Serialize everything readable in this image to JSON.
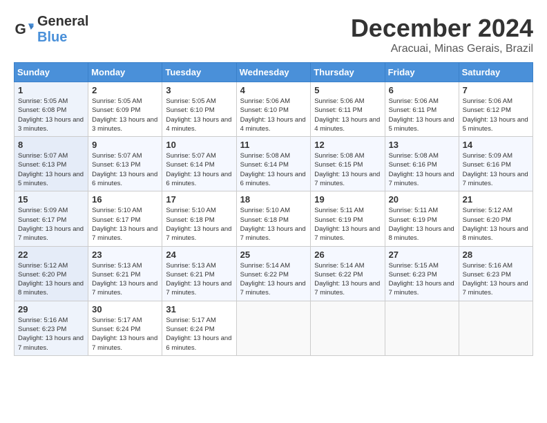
{
  "logo": {
    "general": "General",
    "blue": "Blue"
  },
  "title": "December 2024",
  "location": "Aracuai, Minas Gerais, Brazil",
  "days_of_week": [
    "Sunday",
    "Monday",
    "Tuesday",
    "Wednesday",
    "Thursday",
    "Friday",
    "Saturday"
  ],
  "weeks": [
    [
      {
        "day": "1",
        "sunrise": "5:05 AM",
        "sunset": "6:08 PM",
        "daylight": "13 hours and 3 minutes."
      },
      {
        "day": "2",
        "sunrise": "5:05 AM",
        "sunset": "6:09 PM",
        "daylight": "13 hours and 3 minutes."
      },
      {
        "day": "3",
        "sunrise": "5:05 AM",
        "sunset": "6:10 PM",
        "daylight": "13 hours and 4 minutes."
      },
      {
        "day": "4",
        "sunrise": "5:06 AM",
        "sunset": "6:10 PM",
        "daylight": "13 hours and 4 minutes."
      },
      {
        "day": "5",
        "sunrise": "5:06 AM",
        "sunset": "6:11 PM",
        "daylight": "13 hours and 4 minutes."
      },
      {
        "day": "6",
        "sunrise": "5:06 AM",
        "sunset": "6:11 PM",
        "daylight": "13 hours and 5 minutes."
      },
      {
        "day": "7",
        "sunrise": "5:06 AM",
        "sunset": "6:12 PM",
        "daylight": "13 hours and 5 minutes."
      }
    ],
    [
      {
        "day": "8",
        "sunrise": "5:07 AM",
        "sunset": "6:13 PM",
        "daylight": "13 hours and 5 minutes."
      },
      {
        "day": "9",
        "sunrise": "5:07 AM",
        "sunset": "6:13 PM",
        "daylight": "13 hours and 6 minutes."
      },
      {
        "day": "10",
        "sunrise": "5:07 AM",
        "sunset": "6:14 PM",
        "daylight": "13 hours and 6 minutes."
      },
      {
        "day": "11",
        "sunrise": "5:08 AM",
        "sunset": "6:14 PM",
        "daylight": "13 hours and 6 minutes."
      },
      {
        "day": "12",
        "sunrise": "5:08 AM",
        "sunset": "6:15 PM",
        "daylight": "13 hours and 7 minutes."
      },
      {
        "day": "13",
        "sunrise": "5:08 AM",
        "sunset": "6:16 PM",
        "daylight": "13 hours and 7 minutes."
      },
      {
        "day": "14",
        "sunrise": "5:09 AM",
        "sunset": "6:16 PM",
        "daylight": "13 hours and 7 minutes."
      }
    ],
    [
      {
        "day": "15",
        "sunrise": "5:09 AM",
        "sunset": "6:17 PM",
        "daylight": "13 hours and 7 minutes."
      },
      {
        "day": "16",
        "sunrise": "5:10 AM",
        "sunset": "6:17 PM",
        "daylight": "13 hours and 7 minutes."
      },
      {
        "day": "17",
        "sunrise": "5:10 AM",
        "sunset": "6:18 PM",
        "daylight": "13 hours and 7 minutes."
      },
      {
        "day": "18",
        "sunrise": "5:10 AM",
        "sunset": "6:18 PM",
        "daylight": "13 hours and 7 minutes."
      },
      {
        "day": "19",
        "sunrise": "5:11 AM",
        "sunset": "6:19 PM",
        "daylight": "13 hours and 7 minutes."
      },
      {
        "day": "20",
        "sunrise": "5:11 AM",
        "sunset": "6:19 PM",
        "daylight": "13 hours and 8 minutes."
      },
      {
        "day": "21",
        "sunrise": "5:12 AM",
        "sunset": "6:20 PM",
        "daylight": "13 hours and 8 minutes."
      }
    ],
    [
      {
        "day": "22",
        "sunrise": "5:12 AM",
        "sunset": "6:20 PM",
        "daylight": "13 hours and 8 minutes."
      },
      {
        "day": "23",
        "sunrise": "5:13 AM",
        "sunset": "6:21 PM",
        "daylight": "13 hours and 7 minutes."
      },
      {
        "day": "24",
        "sunrise": "5:13 AM",
        "sunset": "6:21 PM",
        "daylight": "13 hours and 7 minutes."
      },
      {
        "day": "25",
        "sunrise": "5:14 AM",
        "sunset": "6:22 PM",
        "daylight": "13 hours and 7 minutes."
      },
      {
        "day": "26",
        "sunrise": "5:14 AM",
        "sunset": "6:22 PM",
        "daylight": "13 hours and 7 minutes."
      },
      {
        "day": "27",
        "sunrise": "5:15 AM",
        "sunset": "6:23 PM",
        "daylight": "13 hours and 7 minutes."
      },
      {
        "day": "28",
        "sunrise": "5:16 AM",
        "sunset": "6:23 PM",
        "daylight": "13 hours and 7 minutes."
      }
    ],
    [
      {
        "day": "29",
        "sunrise": "5:16 AM",
        "sunset": "6:23 PM",
        "daylight": "13 hours and 7 minutes."
      },
      {
        "day": "30",
        "sunrise": "5:17 AM",
        "sunset": "6:24 PM",
        "daylight": "13 hours and 7 minutes."
      },
      {
        "day": "31",
        "sunrise": "5:17 AM",
        "sunset": "6:24 PM",
        "daylight": "13 hours and 6 minutes."
      },
      null,
      null,
      null,
      null
    ]
  ],
  "labels": {
    "sunrise": "Sunrise:",
    "sunset": "Sunset:",
    "daylight": "Daylight:"
  }
}
